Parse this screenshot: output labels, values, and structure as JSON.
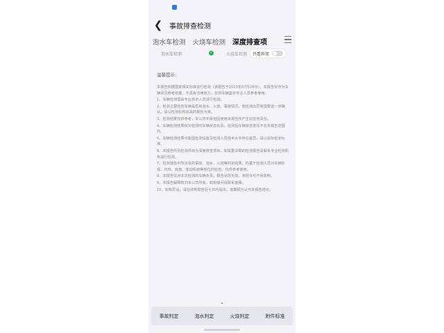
{
  "app": {
    "title": "事故排查检测"
  },
  "tabs": [
    {
      "label": "泡水车检测",
      "active": false
    },
    {
      "label": "火烧车检测",
      "active": false
    },
    {
      "label": "深度排查项",
      "active": true
    }
  ],
  "filter": {
    "option_a": "泡水车检测",
    "option_b": "火烧车检测",
    "toggle_label": "只看异常",
    "toggle_on": false
  },
  "content": {
    "heading": "温馨提示:",
    "paragraphs": [
      "本报告依据国家相关标准进行检测（该报告于2023年07月28日），本报告仅作为车辆状况参考依据，不具有法律效力，仅供车辆鉴定专业人员参考使用。",
      "1、车辆检测需由专业技术人员进行检测。",
      "2、检测主要检查车辆是否有泡水、火烧、事故情况，若检测出异常需要进一步确认，请以检测机构出具的报告为准。",
      "3、检测结果仅供参考，本公司不承担因使用本报告所产生的任何责任。",
      "4、车辆检测结果仅对检测时车辆状态负责，检测后车辆状态变化不在本报告范围内。",
      "5、车辆检测结果可能因检测设备及检测人员技术水平存在差异，请以实际检测为准。",
      "6、本报告所列检测项目为深度排查项目，如需更详细的检测报告请联系专业检测机构进行检测。",
      "7、检测报告中所涉及的事故、泡水、火烧等判定结果，均基于检测人员对车辆外观、内饰、底盘、发动机舱等部位的检查，仅供参考使用。",
      "8、本报告仅对本次检测的车辆负责，报告涂改无效，未经许可不得复制。",
      "9、本报告解释权归本公司所有，如有疑问请联系客服。",
      "10、如有异议，请在收到报告后七日内提出，逾期视为认可本报告结论。"
    ]
  },
  "bottom_nav": [
    "事故判定",
    "泡水判定",
    "火烧判定",
    "附件标准"
  ]
}
